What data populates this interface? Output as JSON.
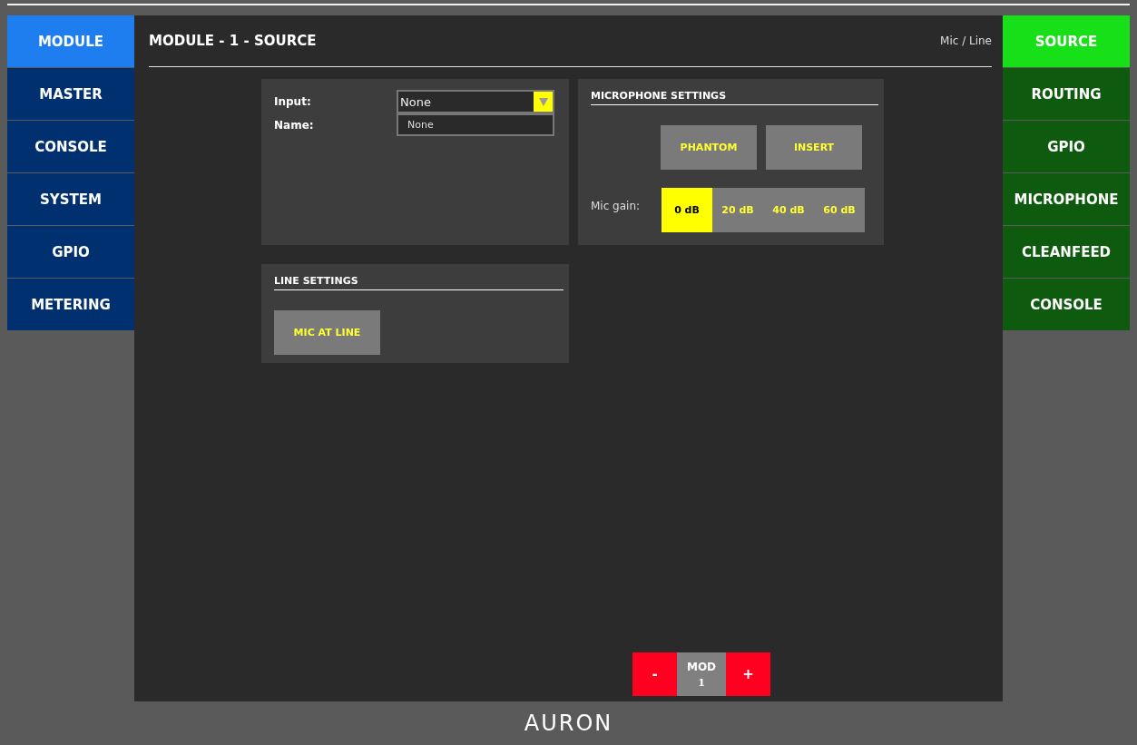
{
  "left_nav": [
    {
      "label": "MODULE",
      "selected": true
    },
    {
      "label": "MASTER",
      "selected": false
    },
    {
      "label": "CONSOLE",
      "selected": false
    },
    {
      "label": "SYSTEM",
      "selected": false
    },
    {
      "label": "GPIO",
      "selected": false
    },
    {
      "label": "METERING",
      "selected": false
    }
  ],
  "header": {
    "title": "MODULE - 1 - SOURCE",
    "subtitle": "Mic / Line"
  },
  "input_panel": {
    "input_label": "Input:",
    "input_value": "None",
    "name_label": "Name:",
    "name_value": "None"
  },
  "microphone_settings": {
    "title": "MICROPHONE SETTINGS",
    "buttons": [
      {
        "label": "PHANTOM",
        "on": false
      },
      {
        "label": "INSERT",
        "on": false
      }
    ],
    "gain_label": "Mic gain:",
    "gain_options": [
      {
        "label": "0 dB",
        "selected": true
      },
      {
        "label": "20 dB",
        "selected": false
      },
      {
        "label": "40 dB",
        "selected": false
      },
      {
        "label": "60 dB",
        "selected": false
      }
    ]
  },
  "line_settings": {
    "title": "LINE SETTINGS",
    "buttons": [
      {
        "label": "MIC AT LINE",
        "on": false
      }
    ]
  },
  "module_selector": {
    "minus": "-",
    "label": "MOD",
    "value": "1",
    "plus": "+"
  },
  "right_nav": [
    {
      "label": "SOURCE",
      "selected": true
    },
    {
      "label": "ROUTING",
      "selected": false
    },
    {
      "label": "GPIO",
      "selected": false
    },
    {
      "label": "MICROPHONE",
      "selected": false
    },
    {
      "label": "CLEANFEED",
      "selected": false
    },
    {
      "label": "CONSOLE",
      "selected": false
    }
  ],
  "footer": {
    "logo": "AURON"
  }
}
